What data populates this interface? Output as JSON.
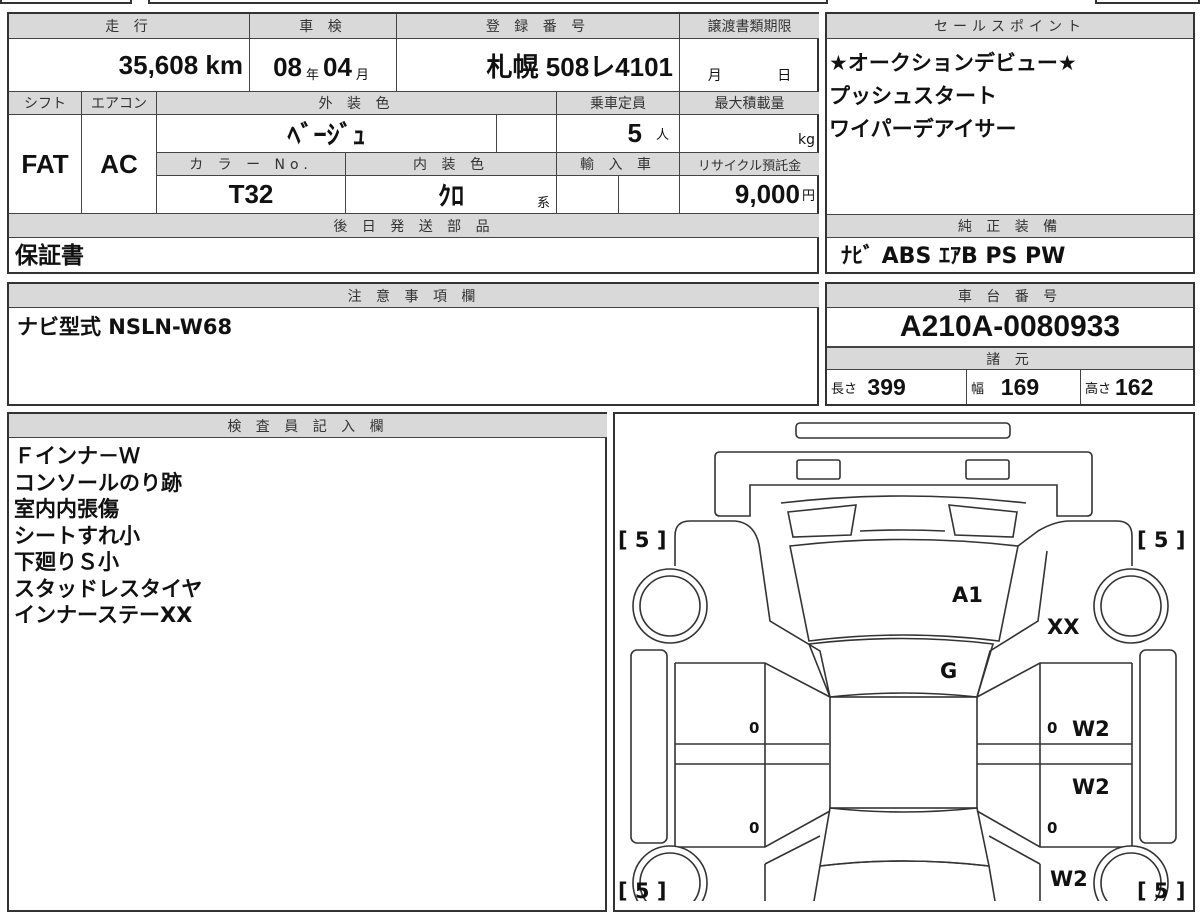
{
  "main_table": {
    "mileage_label": "走 行",
    "mileage_value": "35,608",
    "mileage_unit": "km",
    "inspection_label": "車 検",
    "inspection_year": "08",
    "year_unit": "年",
    "inspection_month": "04",
    "month_unit": "月",
    "registration_label": "登 録 番 号",
    "registration_value": "札幌 508レ4101",
    "transfer_deadline_label": "譲渡書類期限",
    "transfer_month_unit": "月",
    "transfer_day_unit": "日",
    "shift_label": "シフト",
    "shift_value": "FAT",
    "aircon_label": "エアコン",
    "aircon_value": "AC",
    "exterior_color_label": "外 装 色",
    "exterior_color_value": "ﾍﾞｰｼﾞｭ",
    "capacity_label": "乗車定員",
    "capacity_value": "5",
    "capacity_unit": "人",
    "max_load_label": "最大積載量",
    "max_load_unit": "kg",
    "color_no_label": "カ ラ ー No.",
    "color_no_value": "T32",
    "interior_color_label": "内 装 色",
    "interior_color_value": "ｸﾛ",
    "interior_color_suffix": "系",
    "import_label": "輸 入 車",
    "recycle_label": "リサイクル預託金",
    "recycle_value": "9,000",
    "recycle_unit": "円",
    "later_parts_label": "後 日 発 送 部 品",
    "later_parts_value": "保証書"
  },
  "sales_points": {
    "label": "セールスポイント",
    "lines": [
      "★オークションデビュー★",
      "プッシュスタート",
      "ワイパーデアイサー"
    ]
  },
  "equipment": {
    "label": "純 正 装 備",
    "value": "ﾅﾋﾞ ABS ｴｱB PS PW"
  },
  "notes": {
    "label": "注 意 事 項 欄",
    "value": "ナビ型式 NSLN-W68"
  },
  "chassis": {
    "label": "車 台 番 号",
    "value": "A210A-0080933",
    "specs_label": "諸 元",
    "length_label": "長さ",
    "length_value": "399",
    "width_label": "幅",
    "width_value": "169",
    "height_label": "高さ",
    "height_value": "162"
  },
  "inspector": {
    "label": "検 査 員 記 入 欄",
    "lines": [
      "Ｆインナ－Ｗ",
      "コンソールのり跡",
      "室内内張傷",
      "シートすれ小",
      "下廻りＳ小",
      "スタッドレスタイヤ",
      "インナーステーXX"
    ]
  },
  "diagram": {
    "tire_front_left": "[ 5 ]",
    "tire_front_right": "[ 5 ]",
    "tire_rear_left": "[ 5 ]",
    "tire_rear_right": "[ 5 ]",
    "hood": "A1",
    "right_fender": "XX",
    "windshield": "G",
    "left_front_door": "0",
    "right_front_door_0": "0",
    "right_front_door": "W2",
    "right_rear_door": "W2",
    "left_rear_door": "0",
    "right_rear_door_0": "0",
    "right_quarter": "W2"
  }
}
